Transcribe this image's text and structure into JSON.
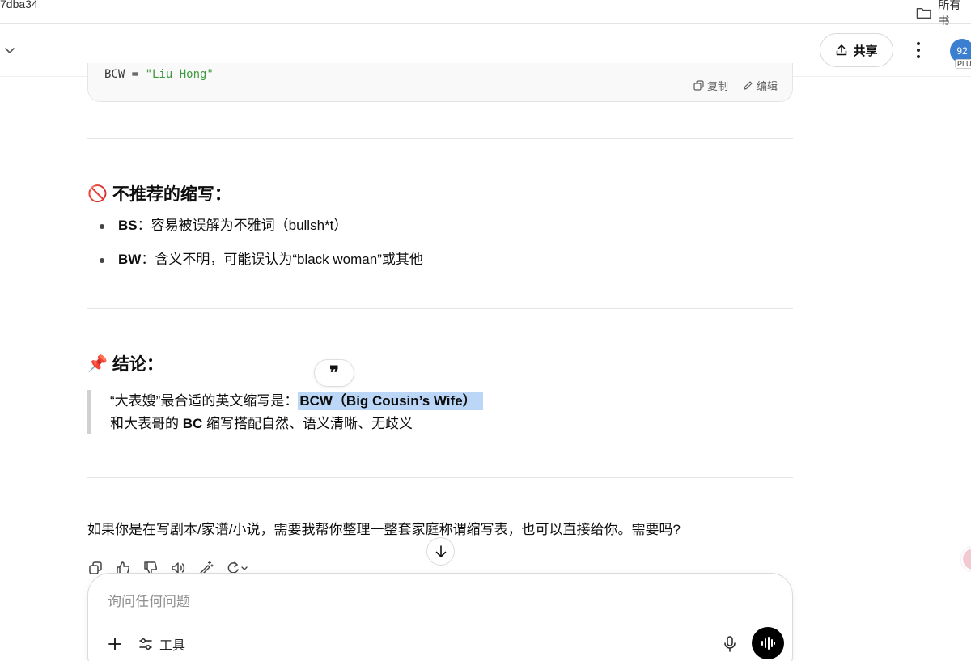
{
  "browser": {
    "url_fragment": "7dba34",
    "bookmarks_label": "所有书"
  },
  "header": {
    "share_label": "共享",
    "avatar_text": "92",
    "plan_badge": "PLU"
  },
  "code_block": {
    "var_text": "BCW = ",
    "string_text": "\"Liu Hong\"",
    "copy_label": "复制",
    "edit_label": "编辑"
  },
  "not_recommended": {
    "emoji": "🚫",
    "heading": "不推荐的缩写：",
    "items": [
      {
        "term": "BS",
        "desc": "：容易被误解为不雅词（bullsh*t）"
      },
      {
        "term": "BW",
        "desc": "：含义不明，可能误认为“black woman”或其他"
      }
    ]
  },
  "conclusion": {
    "emoji": "📌",
    "heading": "结论：",
    "quote_pill": "❞",
    "line1_prefix": "“大表嫂”最合适的英文缩写是：",
    "line1_highlight": "BCW（Big Cousin’s Wife）",
    "line2_prefix": "和大表哥的 ",
    "line2_bold": "BC",
    "line2_suffix": " 缩写搭配自然、语义清晰、无歧义"
  },
  "follow_up": "如果你是在写剧本/家谱/小说，需要我帮你整理一整套家庭称谓缩写表，也可以直接给你。需要吗?",
  "message_actions": [
    "copy-icon",
    "thumbs-up-icon",
    "thumbs-down-icon",
    "speaker-icon",
    "magic-edit-icon",
    "regenerate-icon"
  ],
  "composer": {
    "placeholder": "询问任何问题",
    "tools_label": "工具"
  },
  "colors": {
    "highlight": "#bcd6f7",
    "avatar": "#3b7fd1",
    "code_string": "#3f9a3f"
  }
}
